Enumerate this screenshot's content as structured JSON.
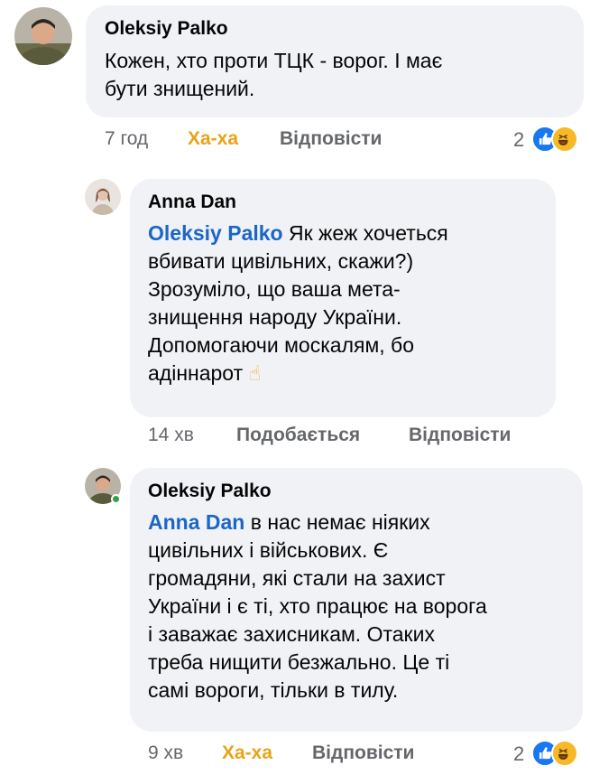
{
  "comments": [
    {
      "author": "Oleksiy Palko",
      "mention": "",
      "lines": [
        "Кожен, хто проти ТЦК - ворог. І має",
        "бути знищений."
      ],
      "time": "7 год",
      "reaction_label": "Ха-ха",
      "reply_label": "Відповісти",
      "reaction_count": "2"
    },
    {
      "author": "Anna Dan",
      "mention": "Oleksiy Palko",
      "lines": [
        "Як жеж хочеться",
        "вбивати цивільних, скажи?)",
        "Зрозуміло, що ваша мета-",
        "знищення народу України.",
        "Допомогаючи москалям, бо",
        "адіннарот"
      ],
      "emoji_end": "☝",
      "time": "14 хв",
      "reaction_label": "Подобається",
      "reply_label": "Відповісти"
    },
    {
      "author": "Oleksiy Palko",
      "mention": "Anna Dan",
      "lines": [
        "в нас немає ніяких",
        "цивільних і військових. Є",
        "громадяни, які стали на захист",
        "України і є ті, хто працює на ворога",
        "і заважає захисникам. Отаких",
        "треба нищити безжально. Це ті",
        "самі вороги, тільки в тилу."
      ],
      "time": "9 хв",
      "reaction_label": "Ха-ха",
      "reply_label": "Відповісти",
      "reaction_count": "2"
    }
  ],
  "colors": {
    "bubble": "#f0f2f5",
    "mention": "#1b66c9",
    "meta_text": "#65676b",
    "haha": "#e8a317",
    "like_blue": "#1877f2",
    "haha_yellow": "#f7b928",
    "online": "#31a24c"
  },
  "icons": [
    "avatar-photo",
    "like-reaction-icon",
    "haha-reaction-icon",
    "pointing-up-emoji"
  ]
}
